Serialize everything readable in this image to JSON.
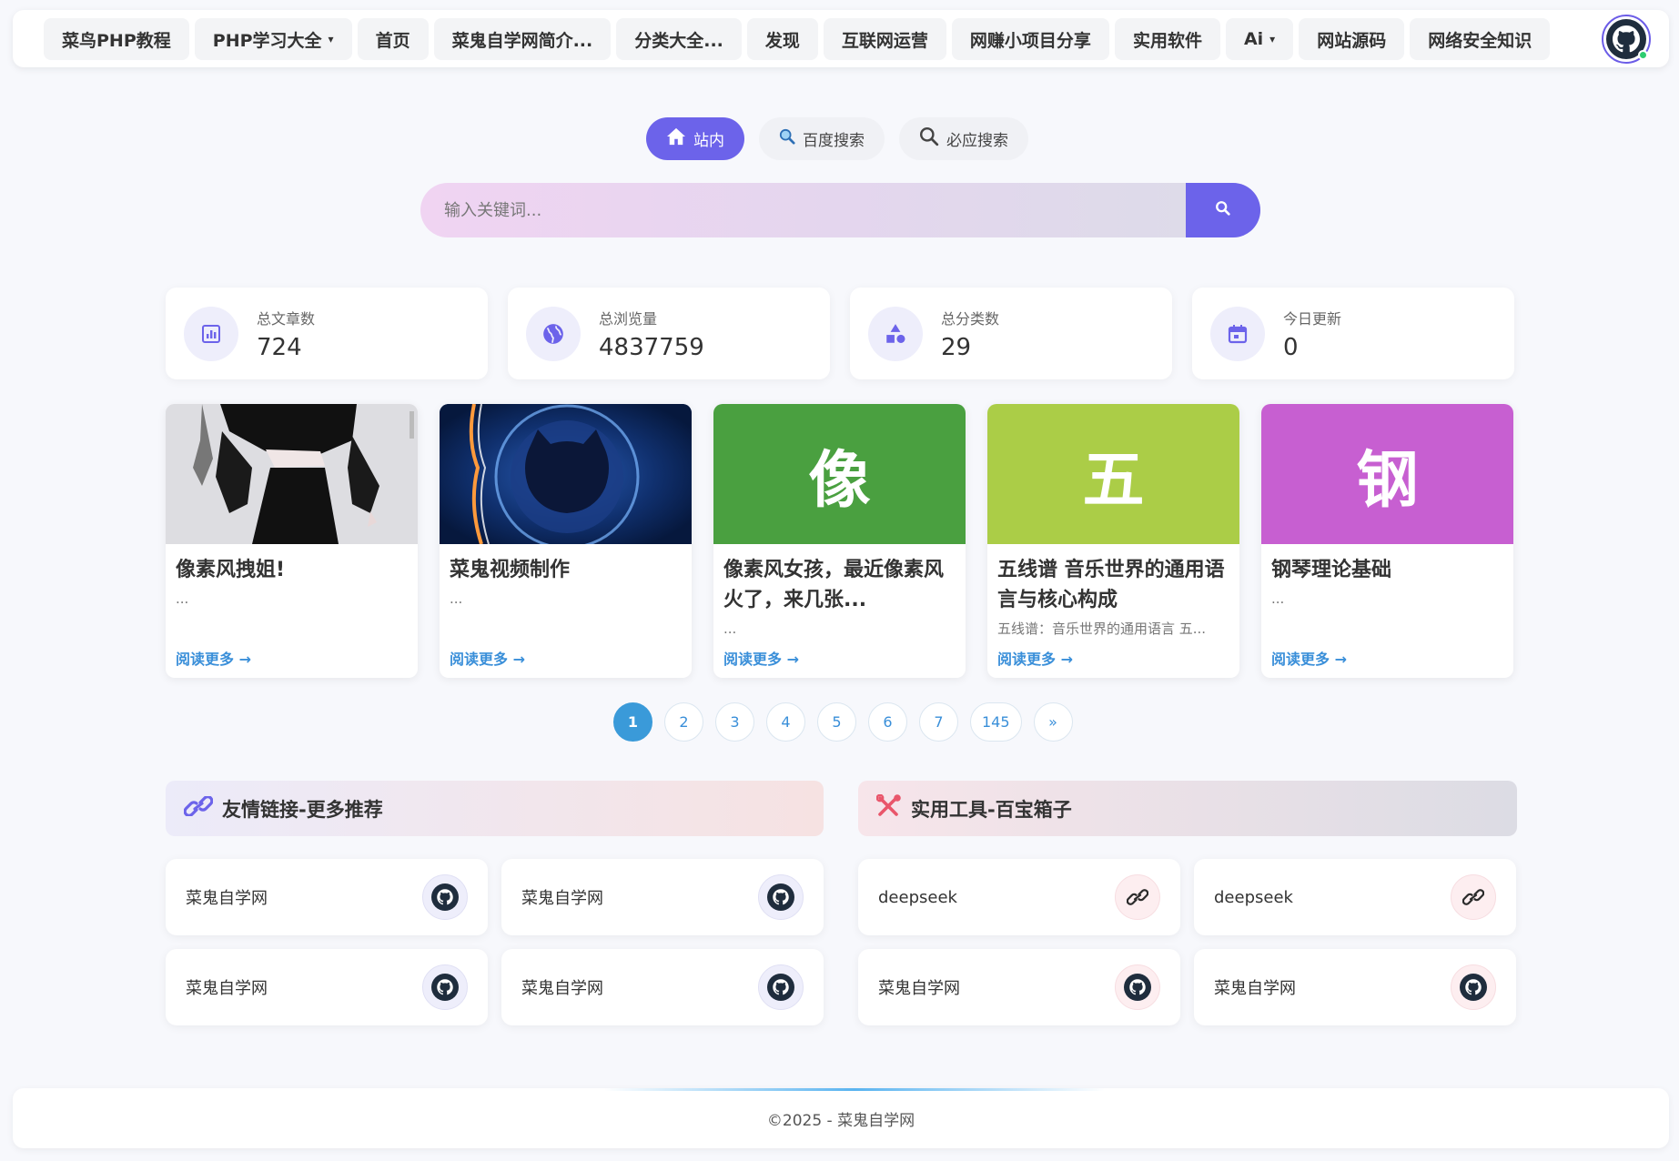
{
  "nav": {
    "items": [
      {
        "label": "菜鸟PHP教程",
        "caret": false
      },
      {
        "label": "PHP学习大全",
        "caret": true
      },
      {
        "label": "首页",
        "caret": false
      },
      {
        "label": "菜鬼自学网简介...",
        "caret": false
      },
      {
        "label": "分类大全...",
        "caret": false
      },
      {
        "label": "发现",
        "caret": false
      },
      {
        "label": "互联网运营",
        "caret": false
      },
      {
        "label": "网赚小项目分享",
        "caret": false
      },
      {
        "label": "实用软件",
        "caret": false
      },
      {
        "label": "Ai",
        "caret": true
      },
      {
        "label": "网站源码",
        "caret": false
      },
      {
        "label": "网络安全知识",
        "caret": false
      }
    ],
    "caret_glyph": "▾"
  },
  "search": {
    "tabs": [
      {
        "label": "站内",
        "icon": "home-icon",
        "active": true
      },
      {
        "label": "百度搜索",
        "icon": "magnifier-emoji-icon",
        "active": false
      },
      {
        "label": "必应搜索",
        "icon": "search-icon",
        "active": false
      }
    ],
    "placeholder": "输入关键词..."
  },
  "stats": [
    {
      "label": "总文章数",
      "value": "724",
      "icon": "chart-icon"
    },
    {
      "label": "总浏览量",
      "value": "4837759",
      "icon": "globe-icon"
    },
    {
      "label": "总分类数",
      "value": "29",
      "icon": "shapes-icon"
    },
    {
      "label": "今日更新",
      "value": "0",
      "icon": "calendar-icon"
    }
  ],
  "articles": [
    {
      "title": "像素风拽姐!",
      "excerpt": "...",
      "more": "阅读更多 →",
      "thumb_type": "image-pixel-girl",
      "thumb_char": "",
      "color": "#dcdce0"
    },
    {
      "title": "菜鬼视频制作",
      "excerpt": "...",
      "more": "阅读更多 →",
      "thumb_type": "image-github-space",
      "thumb_char": "",
      "color": "#0f2a66"
    },
    {
      "title": "像素风女孩，最近像素风火了，来几张...",
      "excerpt": "...",
      "more": "阅读更多 →",
      "thumb_type": "letter",
      "thumb_char": "像",
      "color": "#4aa040"
    },
    {
      "title": "五线谱 音乐世界的通用语言与核心构成",
      "excerpt": "五线谱：音乐世界的通用语言 五...",
      "more": "阅读更多 →",
      "thumb_type": "letter",
      "thumb_char": "五",
      "color": "#abcd47"
    },
    {
      "title": "钢琴理论基础",
      "excerpt": "...",
      "more": "阅读更多 →",
      "thumb_type": "letter",
      "thumb_char": "钢",
      "color": "#c75fd1"
    }
  ],
  "pagination": {
    "pages": [
      "1",
      "2",
      "3",
      "4",
      "5",
      "6",
      "7",
      "145",
      "»"
    ],
    "active": "1"
  },
  "friend_links": {
    "title": "友情链接-更多推荐",
    "items": [
      "菜鬼自学网",
      "菜鬼自学网",
      "菜鬼自学网",
      "菜鬼自学网"
    ]
  },
  "tools": {
    "title": "实用工具-百宝箱子",
    "items": [
      {
        "label": "deepseek",
        "icon": "link-icon"
      },
      {
        "label": "deepseek",
        "icon": "link-icon"
      },
      {
        "label": "菜鬼自学网",
        "icon": "github-icon"
      },
      {
        "label": "菜鬼自学网",
        "icon": "github-icon"
      }
    ]
  },
  "footer": {
    "text": "©2025 - 菜鬼自学网"
  },
  "colors": {
    "accent": "#6c63ea",
    "link_blue": "#3a8fd9",
    "page_active": "#3a9ad9",
    "status_online": "#2ecc71"
  }
}
